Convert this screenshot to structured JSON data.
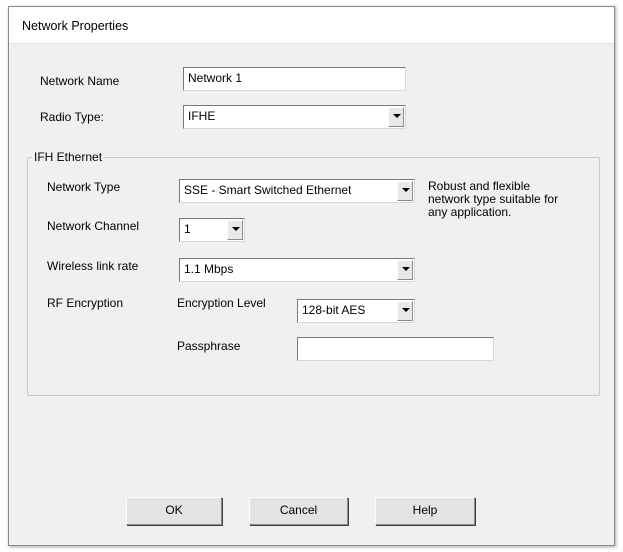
{
  "window": {
    "title": "Network Properties"
  },
  "network_name": {
    "label": "Network Name",
    "value": "Network 1"
  },
  "radio_type": {
    "label": "Radio Type:",
    "value": "IFHE"
  },
  "ifh_ethernet": {
    "group_title": "IFH Ethernet",
    "network_type": {
      "label": "Network Type",
      "value": "SSE - Smart Switched Ethernet",
      "description_lines": [
        "Robust and flexible",
        "network type suitable for",
        "any application."
      ]
    },
    "network_channel": {
      "label": "Network Channel",
      "value": "1"
    },
    "wireless_link_rate": {
      "label": "Wireless link rate",
      "value": "1.1 Mbps"
    },
    "rf_encryption": {
      "label": "RF Encryption",
      "encryption_level_label": "Encryption Level",
      "encryption_level_value": "128-bit AES",
      "passphrase_label": "Passphrase",
      "passphrase_value": ""
    }
  },
  "buttons": {
    "ok": "OK",
    "cancel": "Cancel",
    "help": "Help"
  }
}
